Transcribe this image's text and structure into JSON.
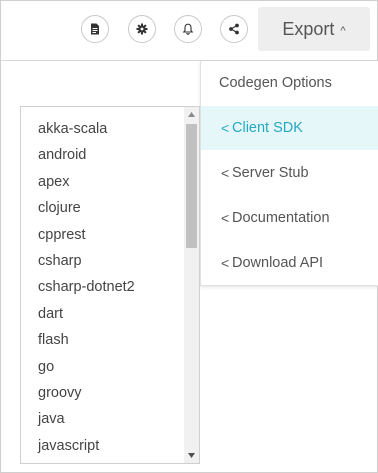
{
  "toolbar": {
    "icons": [
      "file-icon",
      "gear-icon",
      "bell-icon",
      "share-icon"
    ],
    "export_label": "Export",
    "export_caret": "^"
  },
  "export_menu": {
    "header": "Codegen Options",
    "items": [
      {
        "label": "Client SDK",
        "chevron": "<",
        "active": true
      },
      {
        "label": "Server Stub",
        "chevron": "<",
        "active": false
      },
      {
        "label": "Documentation",
        "chevron": "<",
        "active": false
      },
      {
        "label": "Download API",
        "chevron": "<",
        "active": false
      }
    ]
  },
  "sdk_list": {
    "items": [
      "akka-scala",
      "android",
      "apex",
      "clojure",
      "cpprest",
      "csharp",
      "csharp-dotnet2",
      "dart",
      "flash",
      "go",
      "groovy",
      "java",
      "javascript"
    ]
  },
  "colors": {
    "accent": "#25a9c3",
    "active_bg": "#e6f7fa",
    "export_bg": "#eeeeee"
  }
}
